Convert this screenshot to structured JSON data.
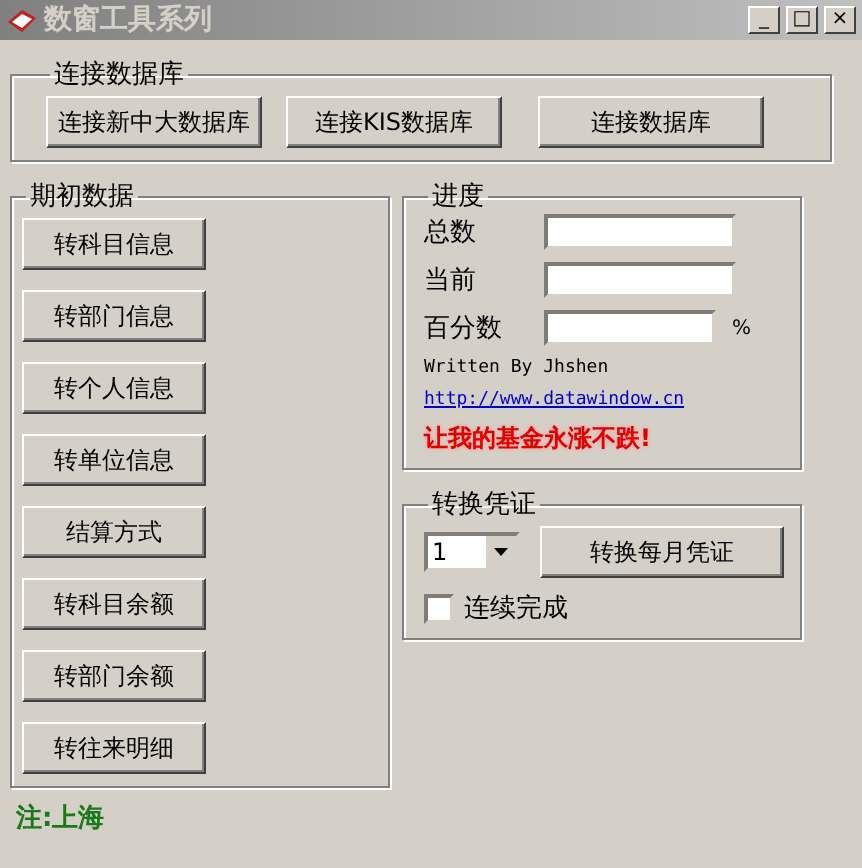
{
  "window": {
    "title": "数窗工具系列",
    "controls": [
      "_",
      "□",
      "×"
    ]
  },
  "connect": {
    "title": "连接数据库",
    "buttons": [
      "连接新中大数据库",
      "连接KIS数据库",
      "连接数据库"
    ]
  },
  "initial": {
    "title": "期初数据",
    "buttons": [
      "转科目信息",
      "转部门信息",
      "转个人信息",
      "转单位信息",
      "结算方式",
      "转科目余额",
      "转部门余额",
      "转往来明细"
    ]
  },
  "progress": {
    "title": "进度",
    "fields": [
      {
        "label": "总数"
      },
      {
        "label": "当前"
      },
      {
        "label": "百分数",
        "suffix": "%"
      }
    ],
    "credit": "Written By Jhshen",
    "link": "http://www.datawindow.cn",
    "slogan": "让我的基金永涨不跌!"
  },
  "convert": {
    "title": "转换凭证",
    "month": "1",
    "button": "转换每月凭证",
    "checkbox": {
      "label": "连续完成",
      "checked": false
    }
  },
  "footer": "注:上海"
}
